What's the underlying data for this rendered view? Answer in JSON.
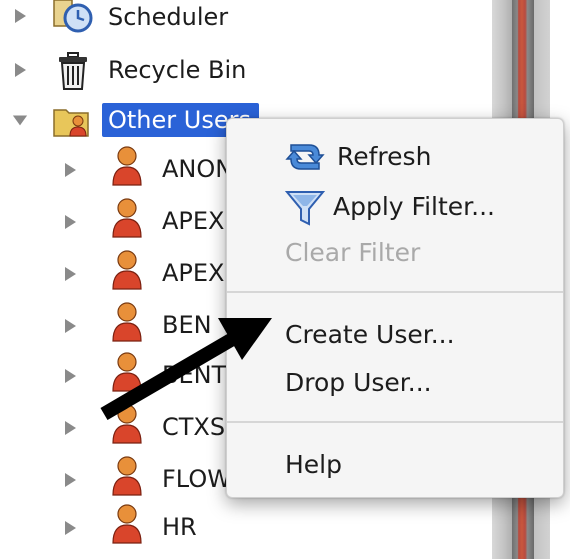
{
  "tree": {
    "items": [
      {
        "label": "Scheduler",
        "icon": "scheduler-icon",
        "expanded": false
      },
      {
        "label": "Recycle Bin",
        "icon": "trash-icon",
        "expanded": false
      },
      {
        "label": "Other Users",
        "icon": "users-folder-icon",
        "expanded": true,
        "selected": true
      }
    ],
    "children": [
      {
        "label": "ANONYMOUS",
        "shown": "ANON"
      },
      {
        "label": "APEX",
        "shown": "APEX"
      },
      {
        "label": "APEX",
        "shown": "APEX"
      },
      {
        "label": "BEN",
        "shown": "BEN"
      },
      {
        "label": "BENT",
        "shown": "BENT"
      },
      {
        "label": "CTXSYS",
        "shown": "CTXS"
      },
      {
        "label": "FLOWS",
        "shown": "FLOW"
      },
      {
        "label": "HR",
        "shown": "HR"
      }
    ]
  },
  "context_menu": {
    "items": [
      {
        "label": "Refresh",
        "icon": "refresh-icon",
        "enabled": true
      },
      {
        "label": "Apply Filter...",
        "icon": "funnel-filter-icon",
        "enabled": true
      },
      {
        "label": "Clear Filter",
        "enabled": false
      },
      {
        "label": "Create User...",
        "enabled": true
      },
      {
        "label": "Drop User...",
        "enabled": true
      },
      {
        "label": "Help",
        "enabled": true
      }
    ]
  },
  "colors": {
    "selection": "#2a62d7",
    "arrow": "#000000",
    "user_icon_head": "#e8903a",
    "user_icon_body": "#d9452b"
  }
}
